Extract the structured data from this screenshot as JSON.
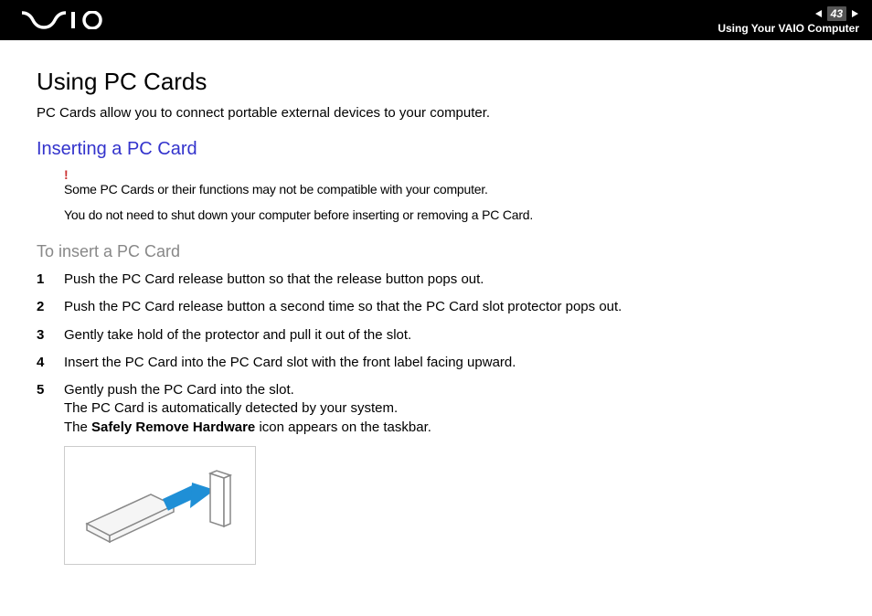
{
  "header": {
    "page_number": "43",
    "section": "Using Your VAIO Computer"
  },
  "content": {
    "title": "Using PC Cards",
    "intro": "PC Cards allow you to connect portable external devices to your computer.",
    "subtitle": "Inserting a PC Card",
    "warning_mark": "!",
    "warning1": "Some PC Cards or their functions may not be compatible with your computer.",
    "warning2": "You do not need to shut down your computer before inserting or removing a PC Card.",
    "procedure_title": "To insert a PC Card",
    "steps": {
      "s1": "Push the PC Card release button so that the release button pops out.",
      "s2": "Push the PC Card release button a second time so that the PC Card slot protector pops out.",
      "s3": "Gently take hold of the protector and pull it out of the slot.",
      "s4": "Insert the PC Card into the PC Card slot with the front label facing upward.",
      "s5a": "Gently push the PC Card into the slot.",
      "s5b": "The PC Card is automatically detected by your system.",
      "s5c_pre": "The ",
      "s5c_bold": "Safely Remove Hardware",
      "s5c_post": " icon appears on the taskbar."
    }
  }
}
